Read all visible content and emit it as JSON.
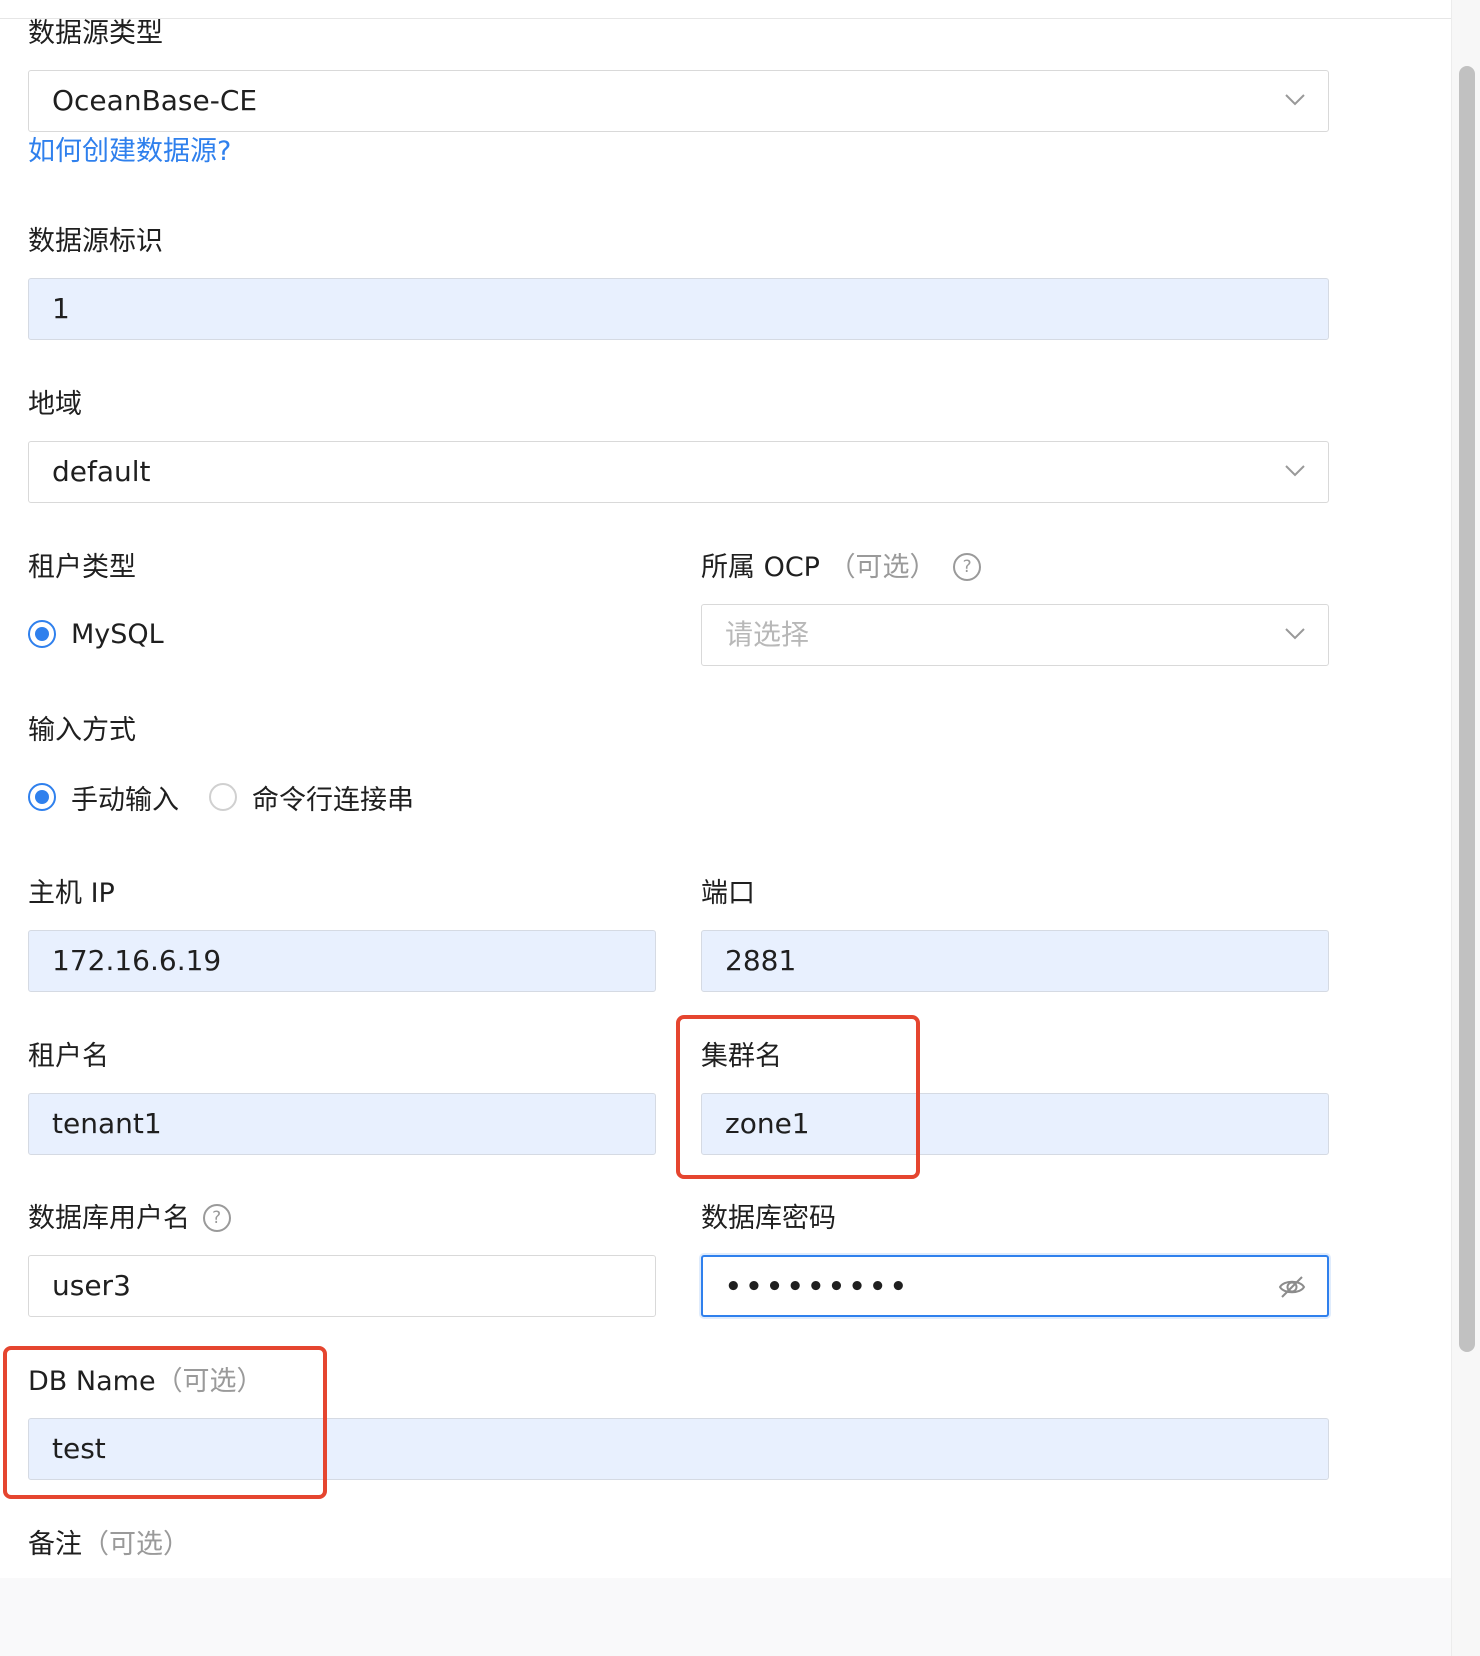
{
  "form": {
    "datasource_type": {
      "label": "数据源类型",
      "value": "OceanBase-CE",
      "help_link": "如何创建数据源?"
    },
    "datasource_id": {
      "label": "数据源标识",
      "value": "1"
    },
    "region": {
      "label": "地域",
      "value": "default"
    },
    "tenant_type": {
      "label": "租户类型",
      "options": [
        "MySQL"
      ],
      "selected": "MySQL"
    },
    "ocp": {
      "label": "所属 OCP",
      "optional": "（可选）",
      "placeholder": "请选择"
    },
    "input_mode": {
      "label": "输入方式",
      "options": [
        "手动输入",
        "命令行连接串"
      ],
      "selected": "手动输入"
    },
    "host": {
      "label": "主机 IP",
      "value": "172.16.6.19"
    },
    "port": {
      "label": "端口",
      "value": "2881"
    },
    "tenant_name": {
      "label": "租户名",
      "value": "tenant1"
    },
    "cluster_name": {
      "label": "集群名",
      "value": "zone1"
    },
    "db_username": {
      "label": "数据库用户名",
      "value": "user3"
    },
    "db_password": {
      "label": "数据库密码",
      "value": "•••••••••"
    },
    "db_name": {
      "label": "DB Name",
      "optional": "（可选）",
      "value": "test"
    },
    "remark": {
      "label": "备注",
      "optional": "（可选）"
    }
  },
  "colors": {
    "accent": "#2f80ed",
    "autofill_bg": "#e8f0fe",
    "annotation_red": "#e5452f"
  },
  "icons": {
    "select_arrow": "chevron-down-icon",
    "help": "question-circle-icon",
    "password_toggle": "eye-invisible-icon"
  }
}
